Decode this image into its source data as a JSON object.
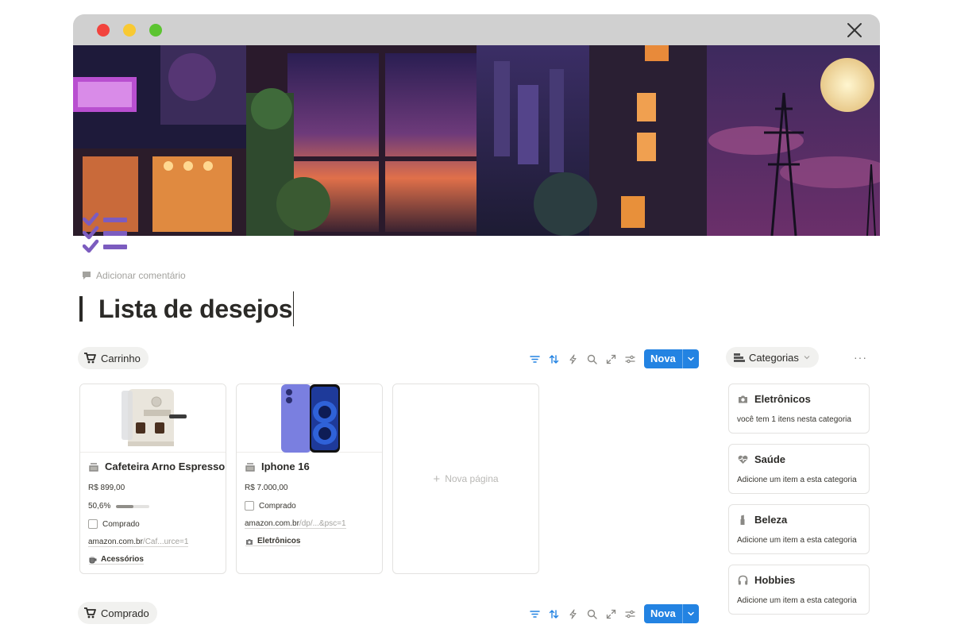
{
  "window": {
    "controls": [
      "close",
      "minimize",
      "maximize"
    ],
    "close_icon": "close-x-icon"
  },
  "page": {
    "icon": "checklist-icon",
    "add_comment": "Adicionar comentário",
    "title": "Lista de desejos"
  },
  "views": {
    "cart": {
      "label": "Carrinho",
      "icon": "cart-icon"
    },
    "bought": {
      "label": "Comprado",
      "icon": "cart-icon"
    }
  },
  "toolbar": {
    "tools": [
      "filter-icon",
      "sort-icon",
      "automation-icon",
      "search-icon",
      "expand-icon",
      "settings-icon"
    ],
    "new_label": "Nova"
  },
  "cards": [
    {
      "title": "Cafeteira Arno Espresso",
      "price": "R$ 899,00",
      "progress_text": "50,6%",
      "progress": 0.506,
      "checkbox_label": "Comprado",
      "checked": false,
      "link_main": "amazon.com.br",
      "link_rest": "/Caf...urce=1",
      "category": "Acessórios",
      "category_icon": "coffee-icon"
    },
    {
      "title": "Iphone 16",
      "price": "R$ 7.000,00",
      "checkbox_label": "Comprado",
      "checked": false,
      "link_main": "amazon.com.br",
      "link_rest": "/dp/...&psc=1",
      "category": "Eletrônicos",
      "category_icon": "camera-icon"
    }
  ],
  "new_page_label": "Nova página",
  "categories": {
    "header": "Categorias",
    "more": "···",
    "items": [
      {
        "name": "Eletrônicos",
        "icon": "camera-icon",
        "desc": "você tem 1 itens nesta categoria"
      },
      {
        "name": "Saúde",
        "icon": "heart-pulse-icon",
        "desc": "Adicione um item a esta categoria"
      },
      {
        "name": "Beleza",
        "icon": "lipstick-icon",
        "desc": "Adicione um item a esta categoria"
      },
      {
        "name": "Hobbies",
        "icon": "headphones-icon",
        "desc": "Adicione um item a esta categoria"
      }
    ]
  },
  "colors": {
    "accent": "#2383e2",
    "page_icon": "#7c5cbf",
    "titlebar": "#d0d0d0"
  }
}
